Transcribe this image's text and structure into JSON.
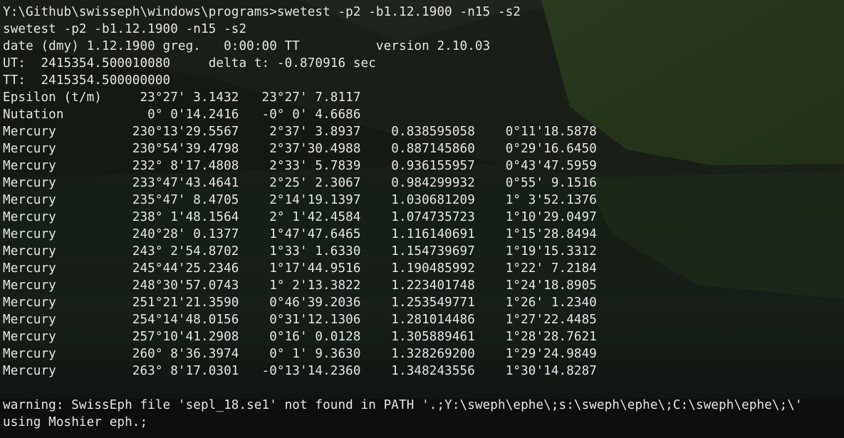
{
  "terminal": {
    "lines": [
      "Y:\\Github\\swisseph\\windows\\programs>swetest -p2 -b1.12.1900 -n15 -s2",
      "swetest -p2 -b1.12.1900 -n15 -s2",
      "date (dmy) 1.12.1900 greg.   0:00:00 TT          version 2.10.03",
      "UT:  2415354.500010080     delta t: -0.870916 sec",
      "TT:  2415354.500000000",
      "Epsilon (t/m)     23°27' 3.1432   23°27' 7.8117",
      "Nutation           0° 0'14.2416   -0° 0' 4.6686",
      "Mercury          230°13'29.5567    2°37' 3.8937    0.838595058    0°11'18.5878",
      "Mercury          230°54'39.4798    2°37'30.4988    0.887145860    0°29'16.6450",
      "Mercury          232° 8'17.4808    2°33' 5.7839    0.936155957    0°43'47.5959",
      "Mercury          233°47'43.4641    2°25' 2.3067    0.984299932    0°55' 9.1516",
      "Mercury          235°47' 8.4705    2°14'19.1397    1.030681209    1° 3'52.1376",
      "Mercury          238° 1'48.1564    2° 1'42.4584    1.074735723    1°10'29.0497",
      "Mercury          240°28' 0.1377    1°47'47.6465    1.116140691    1°15'28.8494",
      "Mercury          243° 2'54.8702    1°33' 1.6330    1.154739697    1°19'15.3312",
      "Mercury          245°44'25.2346    1°17'44.9516    1.190485992    1°22' 7.2184",
      "Mercury          248°30'57.0743    1° 2'13.3822    1.223401748    1°24'18.8905",
      "Mercury          251°21'21.3590    0°46'39.2036    1.253549771    1°26' 1.2340",
      "Mercury          254°14'48.0156    0°31'12.1306    1.281014486    1°27'22.4485",
      "Mercury          257°10'41.2908    0°16' 0.0128    1.305889461    1°28'28.7621",
      "Mercury          260° 8'36.3974    0° 1' 9.3630    1.328269200    1°29'24.9849",
      "Mercury          263° 8'17.0301   -0°13'14.2360    1.348243556    1°30'14.8287",
      "",
      "warning: SwissEph file 'sepl_18.se1' not found in PATH '.;Y:\\sweph\\ephe\\;s:\\sweph\\ephe\\;C:\\sweph\\ephe\\;\\'",
      "using Moshier eph.;"
    ]
  }
}
